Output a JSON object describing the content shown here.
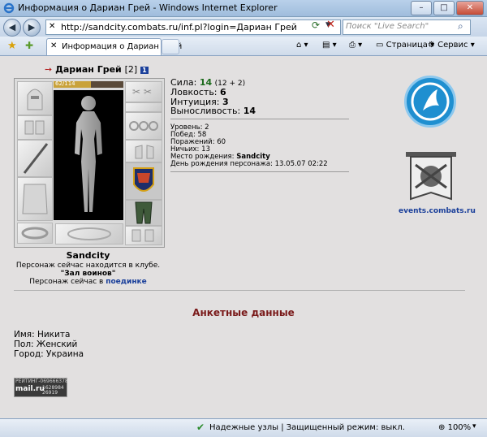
{
  "window": {
    "title": "Информация о Дариан Грей - Windows Internet Explorer"
  },
  "toolbar": {
    "url": "http://sandcity.combats.ru/inf.pl?login=Дариан Грей",
    "search_placeholder": "Поиск \"Live Search\"",
    "tab_label": "Информация о Дариан Грей",
    "page_menu": "Страница",
    "tools_menu": "Сервис"
  },
  "character": {
    "name": "Дариан Грей",
    "level": "[2]",
    "align_badge": "1",
    "hp": "62/114",
    "hp_fraction": 0.54,
    "city": "Sandcity",
    "location_line1": "Персонаж сейчас находится в клубе.",
    "location_line2": "\"Зал воинов\"",
    "location_line3": "Персонаж сейчас в",
    "location_link": "поединке"
  },
  "stats": {
    "strength_label": "Сила:",
    "strength": "14",
    "strength_extra": "(12 + 2)",
    "agility_label": "Ловкость:",
    "agility": "6",
    "intuition_label": "Интуиция:",
    "intuition": "3",
    "endurance_label": "Выносливость:",
    "endurance": "14"
  },
  "info": {
    "level": "Уровень: 2",
    "wins": "Побед: 58",
    "losses": "Поражений: 60",
    "draws": "Ничьих: 13",
    "birthplace_label": "Место рождения:",
    "birthplace": "Sandcity",
    "birthday": "День рождения персонажа: 13.05.07 02:22"
  },
  "events_link": "events.combats.ru",
  "profile": {
    "heading": "Анкетные данные",
    "name": "Имя: Никита",
    "gender": "Пол: Женский",
    "city": "Город: Украина"
  },
  "rating": {
    "top": "РЕЙТИНГ-069666378",
    "brand": "mail.ru",
    "n1": "1628984",
    "n2": "26919"
  },
  "status": {
    "text": "Надежные узлы | Защищенный режим: выкл.",
    "zoom": "100%"
  },
  "colors": {
    "strength_value": "#1c6b1c",
    "link": "#1a3f9a",
    "heading": "#7a1a1a",
    "logo_blue": "#1f8fd0"
  }
}
